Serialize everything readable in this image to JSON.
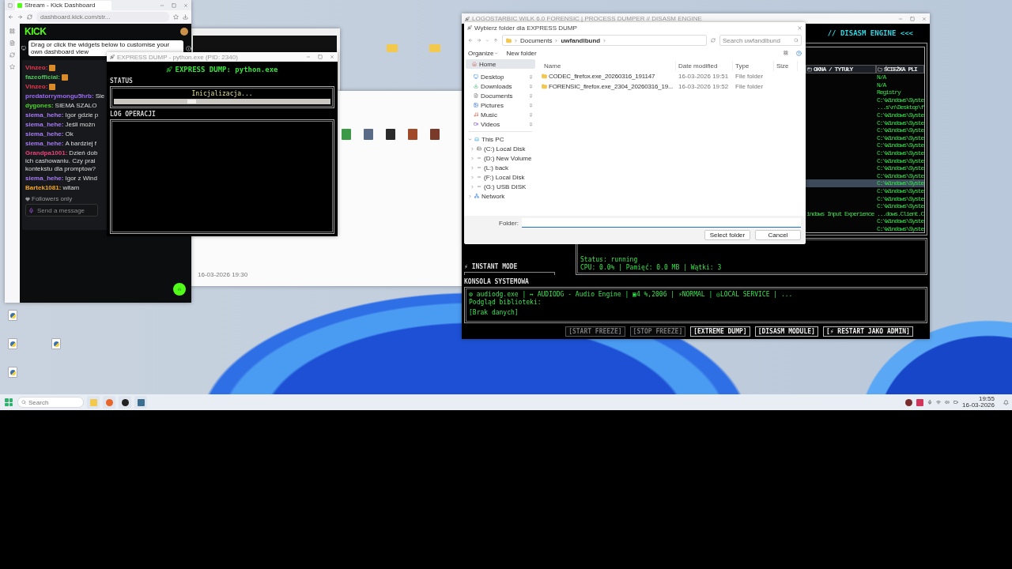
{
  "browser": {
    "tab_title": "Stream - Kick Dashboard",
    "url": "dashboard.kick.com/str...",
    "logo": "KICK",
    "tooltip": "Drag or click the widgets below to customise your own dashboard view",
    "chat": [
      {
        "user": "Vinzeo:",
        "color": "#e8384f",
        "emote": true
      },
      {
        "user": "fazeofficial:",
        "color": "#53c45e",
        "emote": true
      },
      {
        "user": "Vinzeo:",
        "color": "#e8384f",
        "emote": true
      },
      {
        "user": "predatorrymongu5hrb:",
        "color": "#9b6bf2",
        "lines": [
          "Sie"
        ],
        "emote": false
      },
      {
        "user": "dygones:",
        "color": "#4fd12c",
        "lines": [
          "SIEMA SZALO"
        ],
        "emote": false
      },
      {
        "user": "siema_hehe:",
        "color": "#a77bf3",
        "lines": [
          "Igor gdzie p"
        ],
        "emote": false
      },
      {
        "user": "siema_hehe:",
        "color": "#a77bf3",
        "lines": [
          "Jeśli możn"
        ],
        "emote": false
      },
      {
        "user": "siema_hehe:",
        "color": "#a77bf3",
        "lines": [
          "Ok"
        ],
        "emote": false
      },
      {
        "user": "siema_hehe:",
        "color": "#a77bf3",
        "lines": [
          "A bardziej f"
        ],
        "emote": false
      },
      {
        "user": "Grandpa1001:",
        "color": "#e6457a",
        "lines": [
          "Dzień dob",
          "ich cashowaniu. Czy prai",
          "kontekstu dla promptow?"
        ],
        "emote": false
      },
      {
        "user": "siema_hehe:",
        "color": "#a77bf3",
        "lines": [
          "Igor z Wind"
        ],
        "emote": false
      },
      {
        "user": "Bartek1081:",
        "color": "#f5a623",
        "lines": [
          "witam"
        ],
        "emote": false
      }
    ],
    "followers_only": "Followers only",
    "message_placeholder": "Send a message"
  },
  "background_window": {
    "timestamp": "16-03-2026 19:30"
  },
  "express_dump": {
    "window_title": "EXPRESS DUMP - python.exe (PID: 2340)",
    "heading": "EXPRESS DUMP: python.exe",
    "status_label": "STATUS",
    "status_text": "Inicjalizacja...",
    "log_label": "LOG OPERACJI"
  },
  "forensic_app": {
    "window_title": "LOGOSTARBIC WILK 6.0 FORENSIC | PROCESS DUMPER // DISASM ENGINE",
    "header": "// DISASM ENGINE <<<",
    "columns": [
      "OKNA / TYTUŁY",
      "ŚCIEŻKA PLI"
    ],
    "rows": [
      {
        "path": "N/A",
        "selected": false
      },
      {
        "path": "N/A",
        "selected": false
      },
      {
        "path": "Registry",
        "selected": false
      },
      {
        "path": "C:\\Windows\\Syste",
        "selected": false
      },
      {
        "path": "...s\\n\\Desktop\\f",
        "selected": false
      },
      {
        "path": "C:\\Windows\\Syste",
        "selected": false
      },
      {
        "path": "C:\\Windows\\Syste",
        "selected": false
      },
      {
        "path": "C:\\Windows\\Syste",
        "selected": false
      },
      {
        "path": "C:\\Windows\\Syste",
        "selected": false
      },
      {
        "path": "C:\\Windows\\Syste",
        "selected": false
      },
      {
        "path": "C:\\Windows\\Syste",
        "selected": false
      },
      {
        "path": "C:\\Windows\\Syste",
        "selected": false
      },
      {
        "path": "C:\\Windows\\Syste",
        "selected": false
      },
      {
        "path": "C:\\Windows\\Syste",
        "selected": false
      },
      {
        "path": "C:\\Windows\\Syste",
        "selected": true
      },
      {
        "path": "C:\\Windows\\Syste",
        "selected": false
      },
      {
        "path": "C:\\Windows\\Syste",
        "selected": false
      },
      {
        "path": "C:\\Windows\\Syste",
        "selected": false
      },
      {
        "title": "indows Input Experience",
        "path": "...dows.Client.C",
        "selected": false
      },
      {
        "path": "C:\\Windows\\Syste",
        "selected": false
      },
      {
        "path": "C:\\Windows\\Syste",
        "selected": false
      }
    ],
    "mode_label": "⚡ INSTANT MODE",
    "info_lines": [
      "Status: running",
      "CPU: 0.0% | Pamięć: 0.0 MB | Wątki: 3"
    ],
    "console_label": "KONSOLA SYSTEMOWA",
    "console_lines": [
      "⚙ audiodg.exe | ↔ AUDIODG - Audio Engine | ▣4 %,2006 | ⚡NORMAL | ◎LOCAL SERVICE | ...",
      "Podgląd biblioteki:"
    ],
    "console_note": "[Brak danych]",
    "buttons": [
      {
        "label": "[START FREEZE]",
        "disabled": true
      },
      {
        "label": "[STOP FREEZE]",
        "disabled": true
      },
      {
        "label": "[EXTREME DUMP]",
        "disabled": false
      },
      {
        "label": "[DISASM MODULE]",
        "disabled": false
      },
      {
        "label": "[⚡ RESTART JAKO ADMIN]",
        "disabled": false
      }
    ]
  },
  "file_dialog": {
    "title": "Wybierz folder dla EXPRESS DUMP",
    "breadcrumb": [
      "Documents",
      "uwfandlbund"
    ],
    "search_placeholder": "Search uwfandlbund",
    "organize": "Organize",
    "new_folder": "New folder",
    "quick_access": [
      {
        "label": "Home",
        "kind": "home",
        "selected": true
      },
      {
        "label": "Desktop",
        "kind": "desktop",
        "selected": false
      },
      {
        "label": "Downloads",
        "kind": "downloads",
        "selected": false
      },
      {
        "label": "Documents",
        "kind": "documents",
        "selected": false
      },
      {
        "label": "Pictures",
        "kind": "pictures",
        "selected": false
      },
      {
        "label": "Music",
        "kind": "music",
        "selected": false
      },
      {
        "label": "Videos",
        "kind": "videos",
        "selected": false
      }
    ],
    "tree": [
      {
        "label": "This PC",
        "kind": "pc",
        "expanded": true,
        "children": [
          {
            "label": "(C:) Local Disk",
            "kind": "disk"
          },
          {
            "label": "(D:) New Volume",
            "kind": "drive"
          },
          {
            "label": "(L:) back",
            "kind": "drive"
          },
          {
            "label": "(F:) Local Disk",
            "kind": "drive"
          },
          {
            "label": "(G:) USB DISK",
            "kind": "drive"
          }
        ]
      },
      {
        "label": "Network",
        "kind": "network",
        "expanded": false
      }
    ],
    "columns": [
      "Name",
      "Date modified",
      "Type",
      "Size"
    ],
    "files": [
      {
        "name": "CODEC_firefox.exe_20260316_191147",
        "date": "16-03-2026 19:51",
        "type": "File folder"
      },
      {
        "name": "FORENSIC_firefox.exe_2304_20260316_19...",
        "date": "16-03-2026 19:52",
        "type": "File folder"
      }
    ],
    "folder_label": "Folder:",
    "buttons": [
      "Select folder",
      "Cancel"
    ]
  },
  "taskbar": {
    "search_placeholder": "Search",
    "time": "19:55",
    "date": "16-03-2026"
  }
}
